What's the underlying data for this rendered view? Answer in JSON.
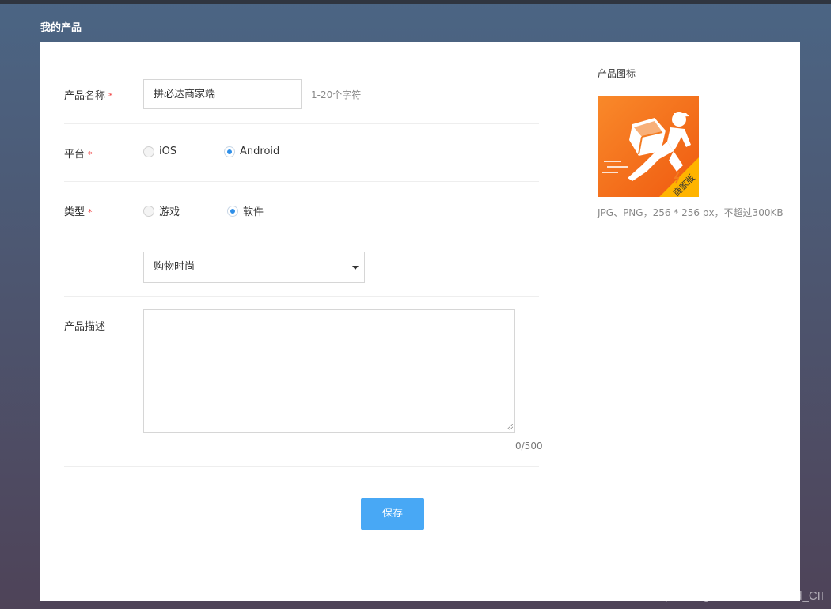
{
  "page": {
    "title": "我的产品"
  },
  "form": {
    "name": {
      "label": "产品名称",
      "required_mark": "*",
      "value": "拼必达商家端",
      "hint": "1-20个字符"
    },
    "platform": {
      "label": "平台",
      "required_mark": "*",
      "options": [
        {
          "label": "iOS",
          "selected": false
        },
        {
          "label": "Android",
          "selected": true
        }
      ]
    },
    "type": {
      "label": "类型",
      "required_mark": "*",
      "options": [
        {
          "label": "游戏",
          "selected": false
        },
        {
          "label": "软件",
          "selected": true
        }
      ]
    },
    "category": {
      "selected": "购物时尚"
    },
    "description": {
      "label": "产品描述",
      "value": "",
      "counter": "0/500"
    },
    "save_label": "保存"
  },
  "icon_panel": {
    "title": "产品图标",
    "badge_text": "商家版",
    "spec": "JPG、PNG，256 * 256 px，不超过300KB"
  },
  "watermark": "https://blog.csdn.net/Android_CII",
  "colors": {
    "accent": "#48a8f5",
    "required": "#f04a4a",
    "icon_orange": "#f5761a",
    "badge_yellow": "#ffb400"
  }
}
